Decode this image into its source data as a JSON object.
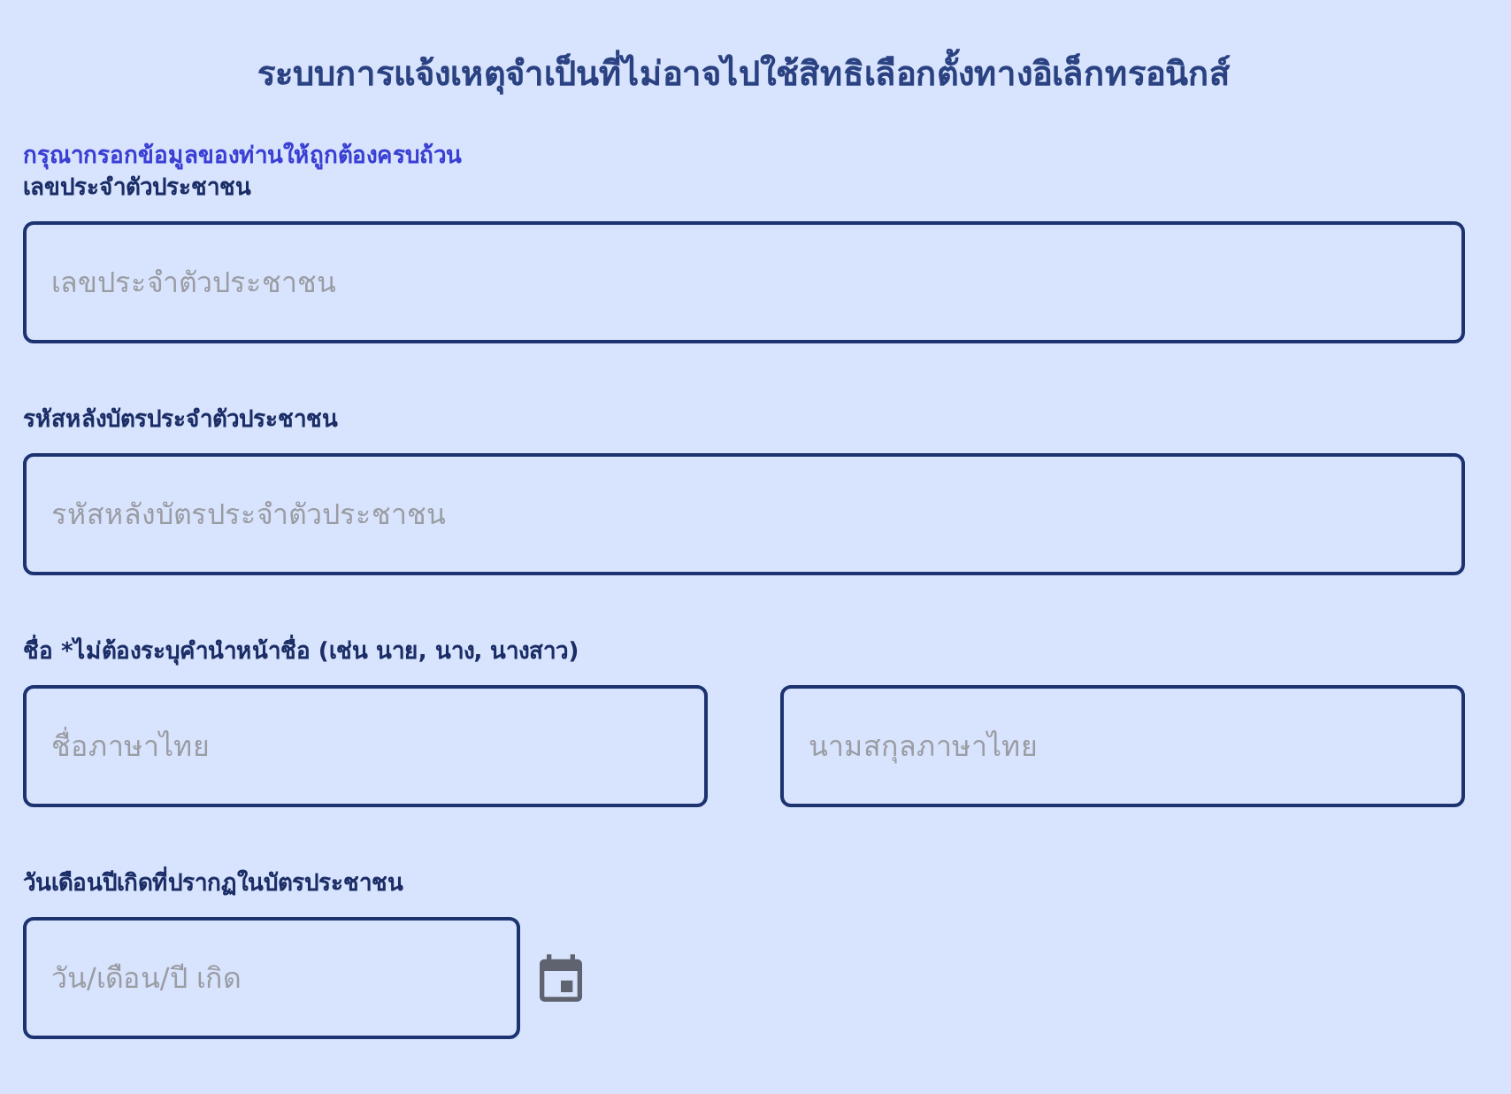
{
  "title": "ระบบการแจ้งเหตุจำเป็นที่ไม่อาจไปใช้สิทธิเลือกตั้งทางอิเล็กทรอนิกส์",
  "instruction": "กรุณากรอกข้อมูลของท่านให้ถูกต้องครบถ้วน",
  "fields": [
    {
      "kind": "single",
      "label": "เลขประจำตัวประชาชน",
      "inputs": [
        {
          "placeholder": "เลขประจำตัวประชาชน"
        }
      ]
    },
    {
      "kind": "single",
      "label": "รหัสหลังบัตรประจำตัวประชาชน",
      "inputs": [
        {
          "placeholder": "รหัสหลังบัตรประจำตัวประชาชน"
        }
      ]
    },
    {
      "kind": "pair",
      "label": "ชื่อ *ไม่ต้องระบุคำนำหน้าชื่อ (เช่น นาย, นาง, นางสาว)",
      "inputs": [
        {
          "placeholder": "ชื่อภาษาไทย"
        },
        {
          "placeholder": "นามสกุลภาษาไทย"
        }
      ]
    },
    {
      "kind": "date",
      "label": "วันเดือนปีเกิดที่ปรากฏในบัตรประชาชน",
      "inputs": [
        {
          "placeholder": "วัน/เดือน/ปี เกิด"
        }
      ]
    }
  ]
}
